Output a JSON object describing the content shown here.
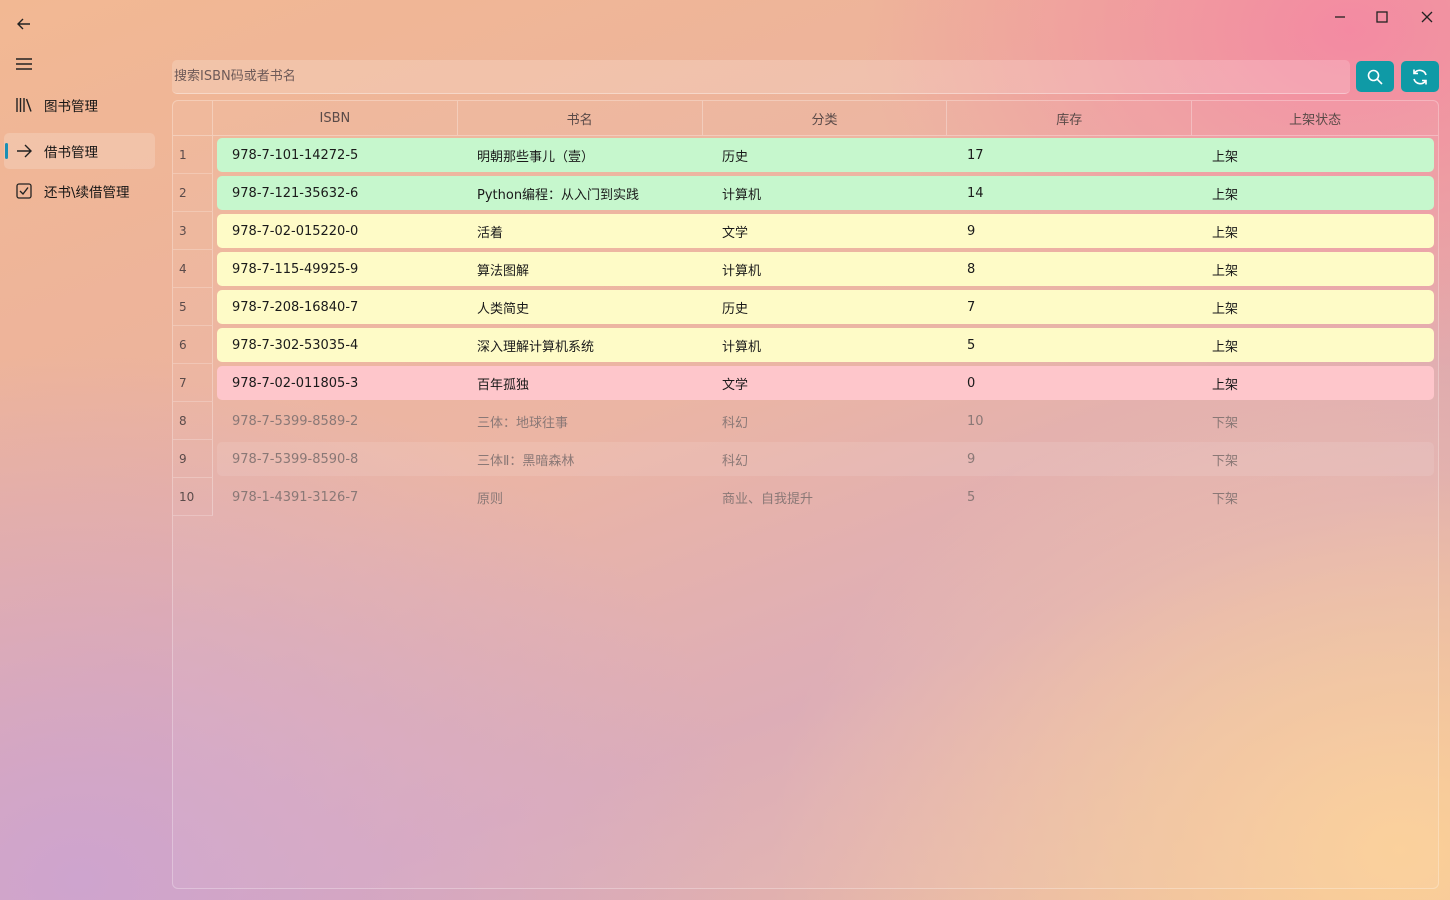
{
  "nav": {
    "items": [
      {
        "label": "图书管理",
        "icon": "library-icon"
      },
      {
        "label": "借书管理",
        "icon": "arrow-right-icon",
        "active": true
      },
      {
        "label": "还书\\续借管理",
        "icon": "checkbox-icon"
      }
    ]
  },
  "search": {
    "placeholder": "搜索ISBN码或者书名",
    "value": ""
  },
  "table": {
    "columns": [
      "ISBN",
      "书名",
      "分类",
      "库存",
      "上架状态"
    ],
    "rows": [
      {
        "num": "1",
        "isbn": "978-7-101-14272-5",
        "title": "明朝那些事儿（壹）",
        "category": "历史",
        "stock": "17",
        "status": "上架",
        "style": "green"
      },
      {
        "num": "2",
        "isbn": "978-7-121-35632-6",
        "title": "Python编程：从入门到实践",
        "category": "计算机",
        "stock": "14",
        "status": "上架",
        "style": "green"
      },
      {
        "num": "3",
        "isbn": "978-7-02-015220-0",
        "title": "活着",
        "category": "文学",
        "stock": "9",
        "status": "上架",
        "style": "yellow"
      },
      {
        "num": "4",
        "isbn": "978-7-115-49925-9",
        "title": "算法图解",
        "category": "计算机",
        "stock": "8",
        "status": "上架",
        "style": "yellow"
      },
      {
        "num": "5",
        "isbn": "978-7-208-16840-7",
        "title": "人类简史",
        "category": "历史",
        "stock": "7",
        "status": "上架",
        "style": "yellow"
      },
      {
        "num": "6",
        "isbn": "978-7-302-53035-4",
        "title": "深入理解计算机系统",
        "category": "计算机",
        "stock": "5",
        "status": "上架",
        "style": "yellow"
      },
      {
        "num": "7",
        "isbn": "978-7-02-011805-3",
        "title": "百年孤独",
        "category": "文学",
        "stock": "0",
        "status": "上架",
        "style": "red"
      },
      {
        "num": "8",
        "isbn": "978-7-5399-8589-2",
        "title": "三体：地球往事",
        "category": "科幻",
        "stock": "10",
        "status": "下架",
        "style": "off"
      },
      {
        "num": "9",
        "isbn": "978-7-5399-8590-8",
        "title": "三体Ⅱ：黑暗森林",
        "category": "科幻",
        "stock": "9",
        "status": "下架",
        "style": "off hover"
      },
      {
        "num": "10",
        "isbn": "978-1-4391-3126-7",
        "title": "原则",
        "category": "商业、自我提升",
        "stock": "5",
        "status": "下架",
        "style": "off"
      }
    ]
  },
  "colors": {
    "accent": "#0f9aa6",
    "nav_indicator": "#1a8fb4",
    "row_green": "#c6f7cd",
    "row_yellow": "#fefbc7",
    "row_red": "#fec6cb"
  }
}
